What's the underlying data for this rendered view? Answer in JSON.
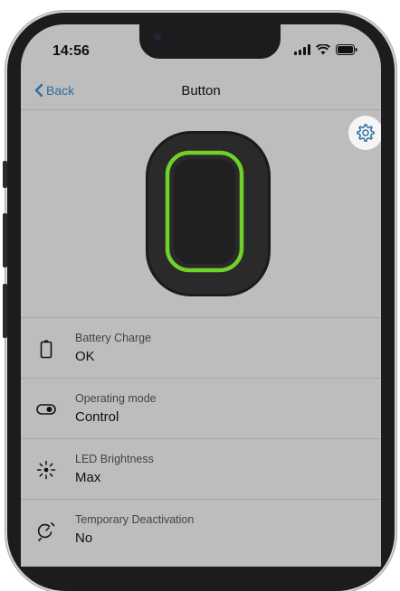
{
  "status_bar": {
    "time": "14:56"
  },
  "nav": {
    "back_label": "Back",
    "title": "Button"
  },
  "icons": {
    "back": "chevron-left-icon",
    "settings": "gear-icon",
    "battery": "battery-icon",
    "operating_mode": "toggle-icon",
    "led": "brightness-icon",
    "deactivation": "deactivation-icon"
  },
  "colors": {
    "accent": "#2a6ea0",
    "led_ring": "#6fd12a",
    "screen_bg": "#bdbdbd"
  },
  "rows": [
    {
      "label": "Battery Charge",
      "value": "OK"
    },
    {
      "label": "Operating mode",
      "value": "Control"
    },
    {
      "label": "LED Brightness",
      "value": "Max"
    },
    {
      "label": "Temporary Deactivation",
      "value": "No"
    }
  ]
}
